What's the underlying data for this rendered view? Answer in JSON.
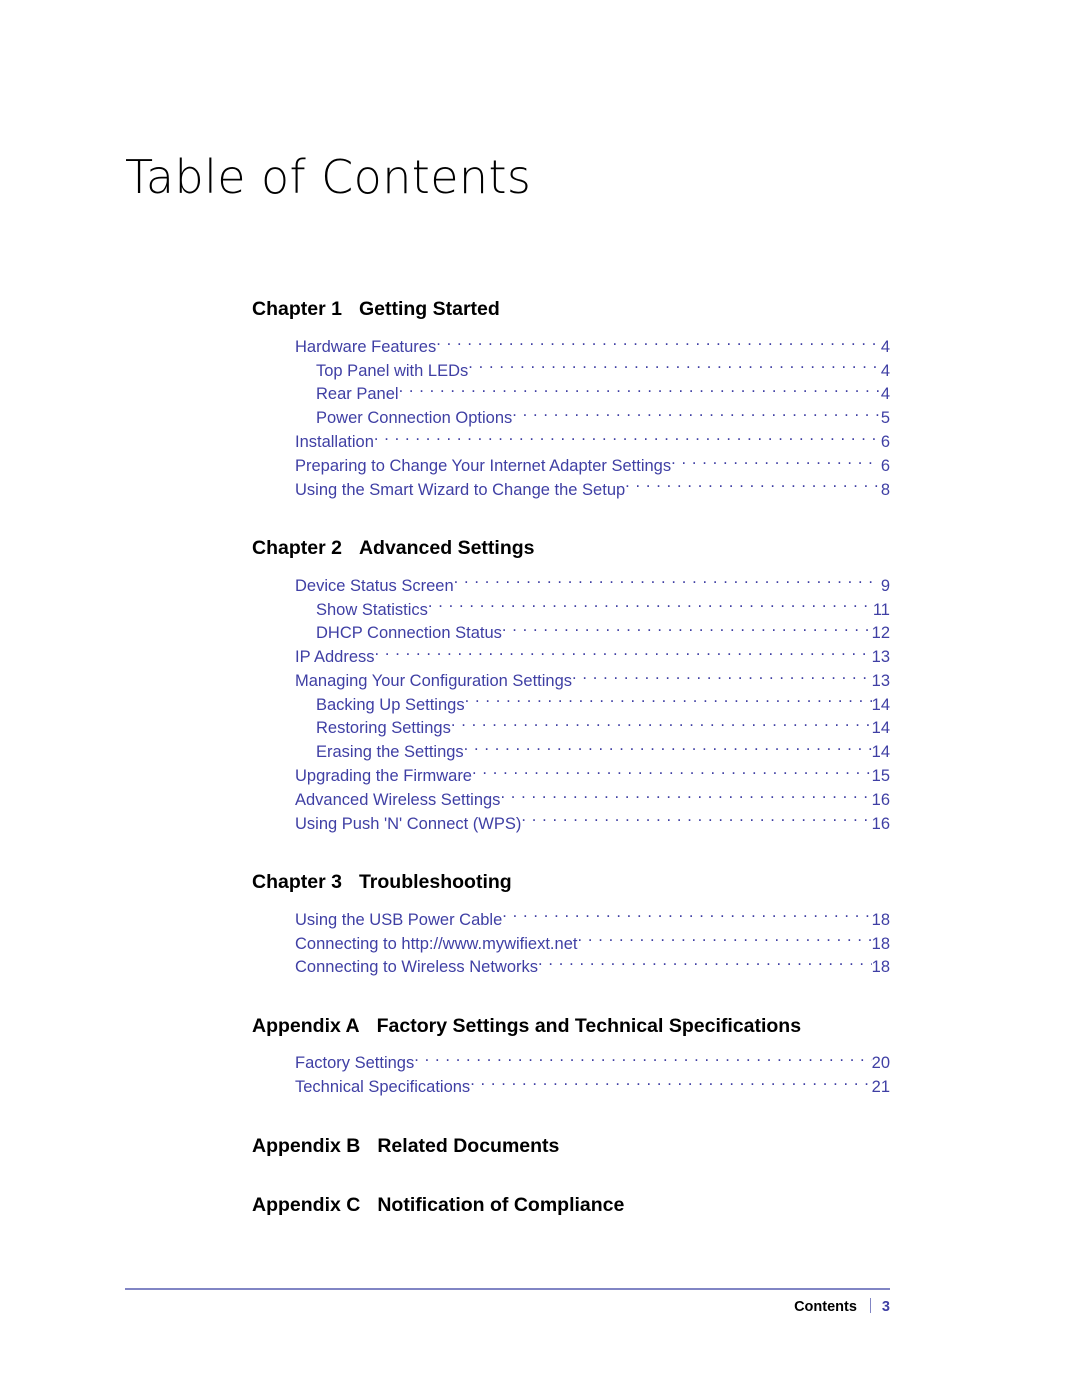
{
  "document": {
    "title": "Table of Contents"
  },
  "toc": {
    "groups": [
      {
        "number": "Chapter 1",
        "title": "Getting Started",
        "entries": [
          {
            "label": "Hardware Features",
            "page": "4",
            "level": 1
          },
          {
            "label": "Top Panel with LEDs",
            "page": "4",
            "level": 2
          },
          {
            "label": "Rear Panel",
            "page": "4",
            "level": 2
          },
          {
            "label": "Power Connection Options",
            "page": "5",
            "level": 2
          },
          {
            "label": "Installation",
            "page": "6",
            "level": 1
          },
          {
            "label": "Preparing to Change Your Internet Adapter Settings",
            "page": "6",
            "level": 1
          },
          {
            "label": "Using the Smart Wizard to Change the Setup",
            "page": "8",
            "level": 1
          }
        ]
      },
      {
        "number": "Chapter 2",
        "title": "Advanced Settings",
        "entries": [
          {
            "label": "Device Status Screen",
            "page": "9",
            "level": 1
          },
          {
            "label": "Show Statistics",
            "page": "11",
            "level": 2
          },
          {
            "label": "DHCP Connection Status",
            "page": "12",
            "level": 2
          },
          {
            "label": "IP Address",
            "page": "13",
            "level": 1
          },
          {
            "label": "Managing Your Configuration Settings",
            "page": "13",
            "level": 1
          },
          {
            "label": "Backing Up Settings",
            "page": "14",
            "level": 2
          },
          {
            "label": "Restoring Settings",
            "page": "14",
            "level": 2
          },
          {
            "label": "Erasing the Settings",
            "page": "14",
            "level": 2
          },
          {
            "label": "Upgrading the Firmware",
            "page": "15",
            "level": 1
          },
          {
            "label": "Advanced Wireless Settings",
            "page": "16",
            "level": 1
          },
          {
            "label": "Using Push 'N' Connect (WPS)",
            "page": "16",
            "level": 1
          }
        ]
      },
      {
        "number": "Chapter 3",
        "title": "Troubleshooting",
        "entries": [
          {
            "label": "Using the USB Power Cable",
            "page": "18",
            "level": 1
          },
          {
            "label": "Connecting to http://www.mywifiext.net",
            "page": "18",
            "level": 1
          },
          {
            "label": "Connecting to Wireless Networks",
            "page": "18",
            "level": 1
          }
        ]
      },
      {
        "number": "Appendix A",
        "title": "Factory Settings and Technical Specifications",
        "entries": [
          {
            "label": "Factory Settings",
            "page": "20",
            "level": 1
          },
          {
            "label": "Technical Specifications",
            "page": "21",
            "level": 1
          }
        ]
      },
      {
        "number": "Appendix B",
        "title": "Related Documents",
        "entries": []
      },
      {
        "number": "Appendix C",
        "title": "Notification of Compliance",
        "entries": []
      }
    ]
  },
  "footer": {
    "label": "Contents",
    "page": "3",
    "rule_color": "#8185c4",
    "accent_color": "#3f3fa4"
  }
}
